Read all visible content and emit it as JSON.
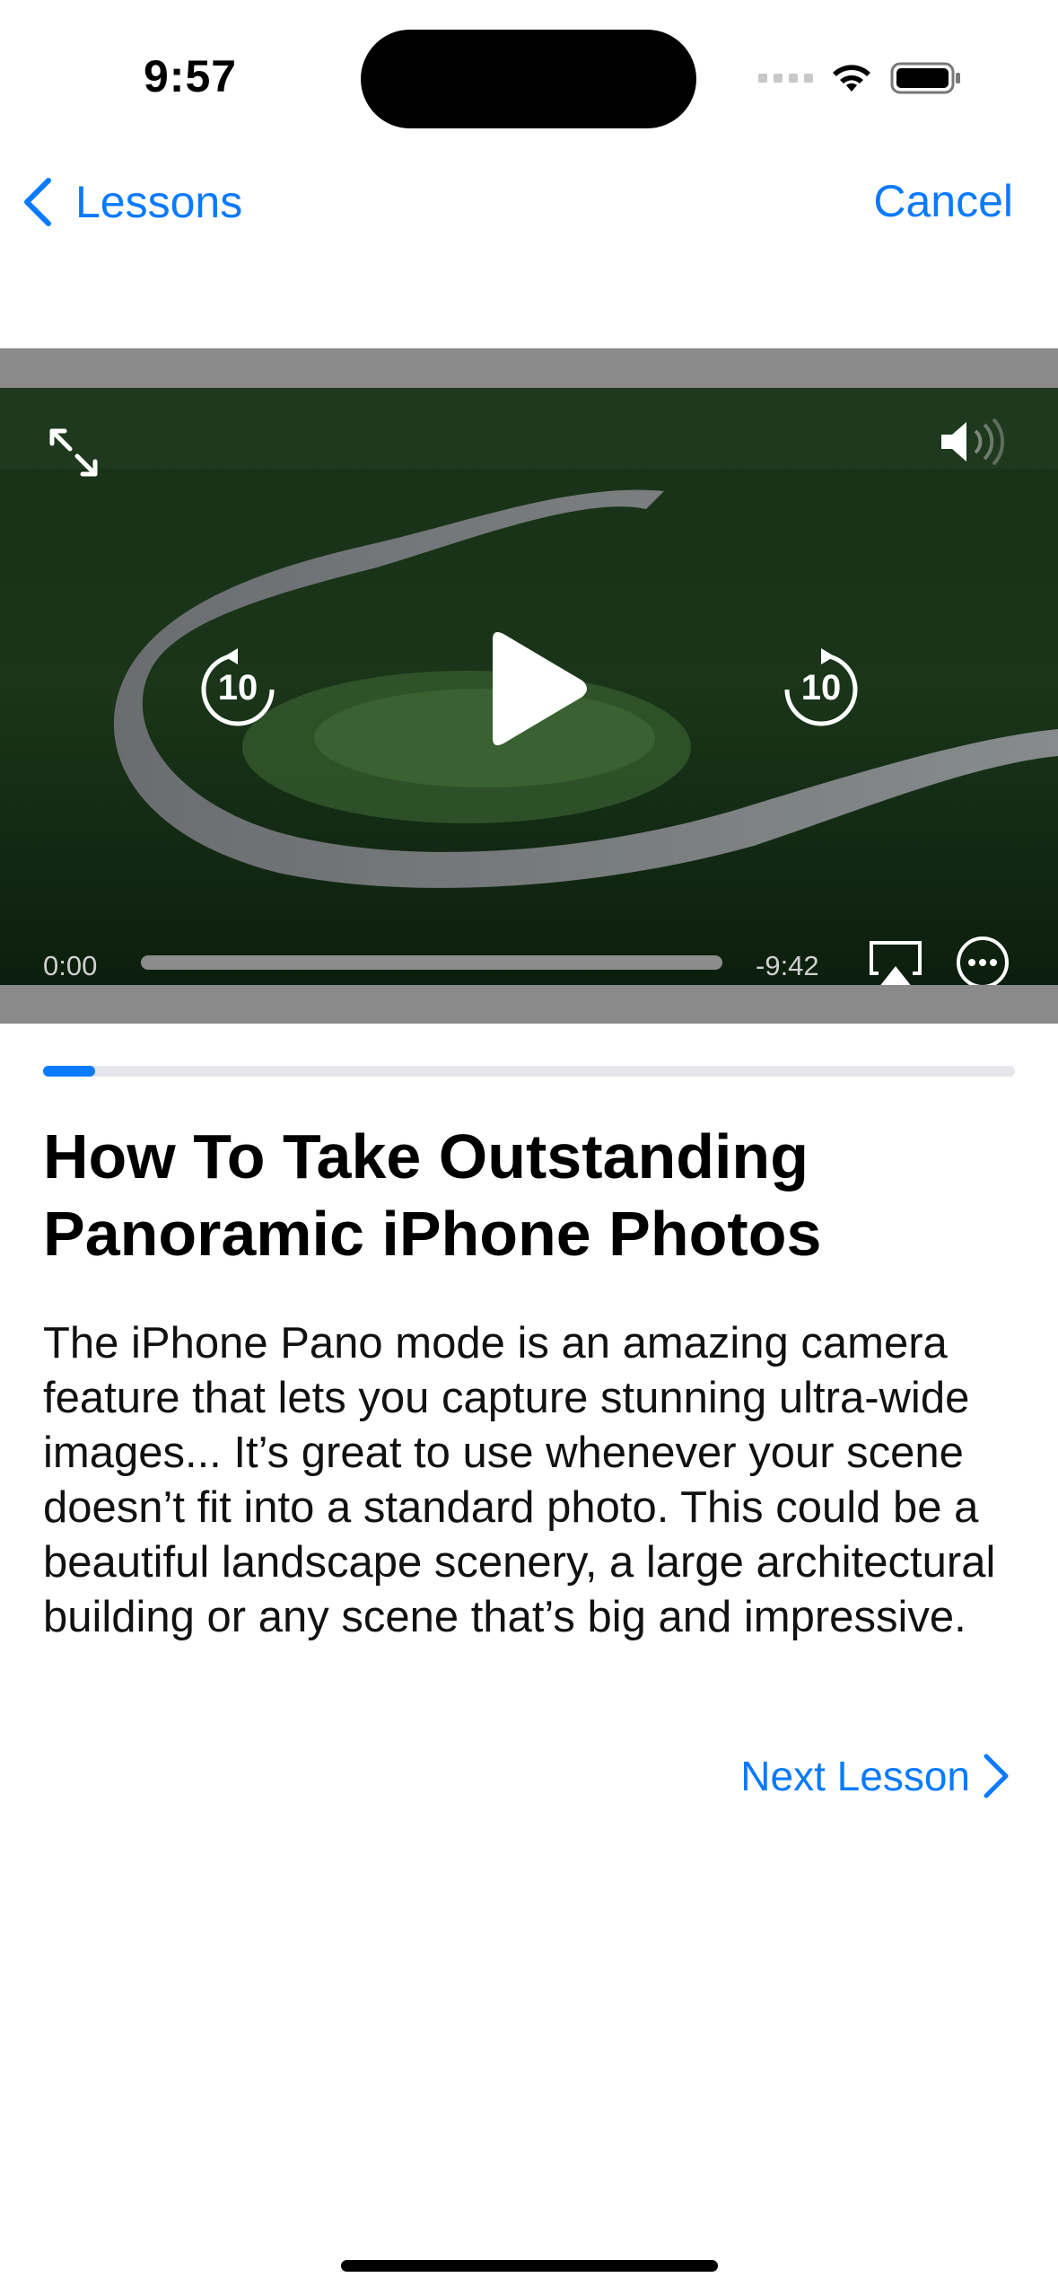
{
  "status_bar": {
    "time": "9:57"
  },
  "nav": {
    "back_label": "Lessons",
    "cancel_label": "Cancel"
  },
  "player": {
    "elapsed": "0:00",
    "remaining": "-9:42",
    "skip_back_seconds": "10",
    "skip_forward_seconds": "10",
    "playback_progress": 0
  },
  "lesson": {
    "progress": 0.054,
    "title_line1": "How To Take Outstanding",
    "title_line2": "Panoramic iPhone Photos",
    "description": "The iPhone Pano mode is an amazing camera feature that lets you capture stunning ultra-wide images... It’s great to use whenever your scene doesn’t fit into a standard photo. This could be a beautiful landscape scenery, a large architectural building or any scene that’s big and impressive.",
    "next_label": "Next Lesson"
  },
  "colors": {
    "accent": "#0a7aff"
  },
  "icons": [
    "chevron-left-icon",
    "expand-icon",
    "speaker-icon",
    "skip-back-10-icon",
    "play-icon",
    "skip-forward-10-icon",
    "airplay-icon",
    "more-icon",
    "chevron-right-icon",
    "wifi-icon",
    "battery-icon",
    "signal-icon"
  ]
}
